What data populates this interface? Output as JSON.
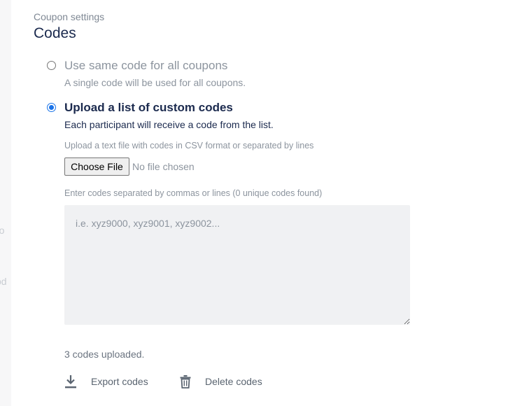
{
  "header": {
    "breadcrumb": "Coupon settings",
    "title": "Codes"
  },
  "options": [
    {
      "label": "Use same code for all coupons",
      "description": "A single code will be used for all coupons.",
      "selected": false
    },
    {
      "label": "Upload a list of custom codes",
      "description": "Each participant will receive a code from the list.",
      "selected": true
    }
  ],
  "upload": {
    "hint": "Upload a text file with codes in CSV format or separated by lines",
    "button_label": "Choose File",
    "file_status": "No file chosen"
  },
  "codes_input": {
    "hint": "Enter codes separated by commas or lines (0 unique codes found)",
    "placeholder": "i.e. xyz9000, xyz9001, xyz9002...",
    "value": ""
  },
  "status": {
    "uploaded_text": "3 codes uploaded."
  },
  "actions": {
    "export_label": "Export codes",
    "delete_label": "Delete codes"
  },
  "colors": {
    "accent": "#1a73e8",
    "heading": "#1b2a4e",
    "muted": "#8c949e"
  }
}
